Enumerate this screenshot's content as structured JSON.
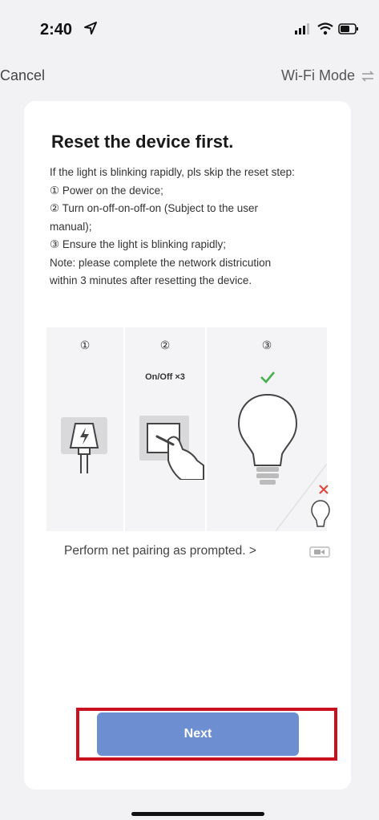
{
  "status_bar": {
    "time": "2:40"
  },
  "nav": {
    "cancel_label": "Cancel",
    "mode_label": "Wi-Fi Mode"
  },
  "card": {
    "title": "Reset the device first.",
    "instructions": [
      "If the light is blinking rapidly, pls skip the reset step:",
      "① Power on the device;",
      "② Turn on-off-on-off-on (Subject to the user",
      "manual);",
      "③ Ensure the light is blinking rapidly;",
      "Note: please complete the network districution",
      "within 3 minutes after resetting the device."
    ],
    "illustration": {
      "steps": [
        "①",
        "②",
        "③"
      ],
      "step2_caption": "On/Off ×3"
    },
    "pairing_link": "Perform net pairing as prompted. >"
  },
  "next_label": "Next",
  "colors": {
    "primary_button": "#6d8fd2",
    "highlight_outline": "#c8101e",
    "check": "#43b04a",
    "cross": "#e0443a"
  }
}
